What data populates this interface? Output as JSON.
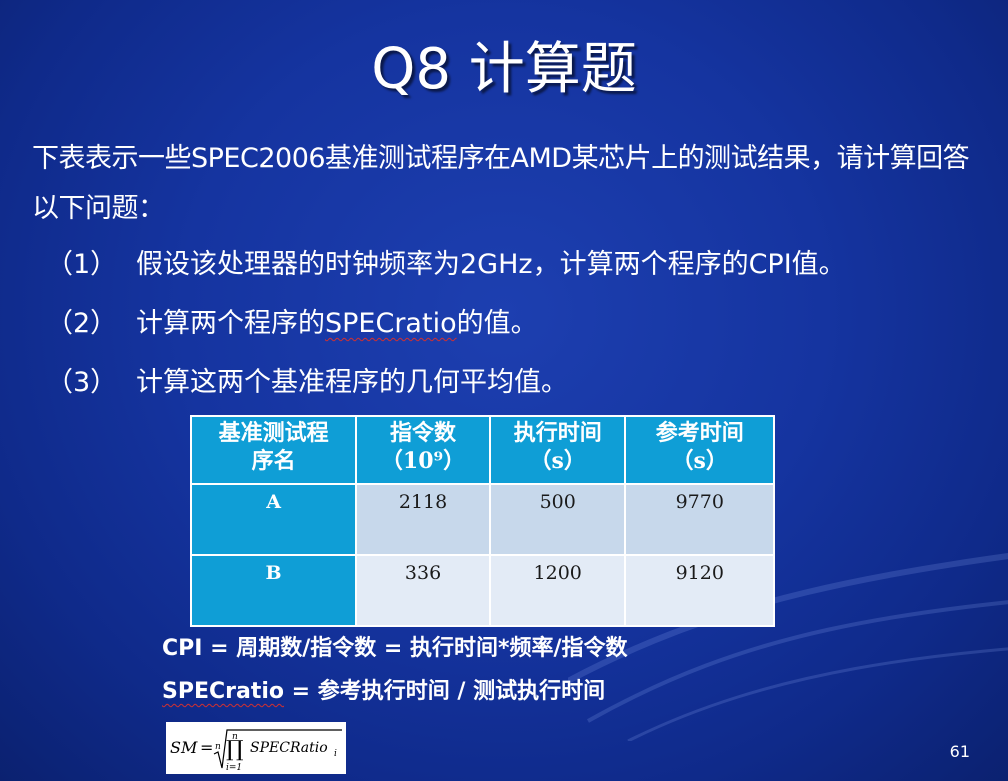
{
  "title": "Q8 计算题",
  "intro": "下表表示一些SPEC2006基准测试程序在AMD某芯片上的测试结果，请计算回答以下问题：",
  "questions": [
    {
      "num": "（1）",
      "text": "假设该处理器的时钟频率为2GHz，计算两个程序的CPI值。"
    },
    {
      "num": "（2）",
      "text_a": "计算两个程序的",
      "text_b": "SPECratio",
      "text_c": "的值。"
    },
    {
      "num": "（3）",
      "text": "计算这两个基准程序的几何平均值。"
    }
  ],
  "table": {
    "headers": [
      {
        "line1": "基准测试程",
        "line2": "序名"
      },
      {
        "line1": "指令数",
        "line2": "（10⁹）"
      },
      {
        "line1": "执行时间",
        "line2": "（s）"
      },
      {
        "line1": "参考时间",
        "line2": "（s）"
      }
    ],
    "rows": [
      {
        "name": "A",
        "instr": "2118",
        "exec": "500",
        "ref": "9770"
      },
      {
        "name": "B",
        "instr": "336",
        "exec": "1200",
        "ref": "9120"
      }
    ]
  },
  "formula1": "CPI = 周期数/指令数 = 执行时间*频率/指令数",
  "formula2_a": "SPECratio",
  "formula2_b": " = 参考执行时间 / 测试执行时间",
  "sm_formula": {
    "lhs": "SM",
    "eq": "=",
    "root_index": "n",
    "prod_upper": "n",
    "prod_lower": "i=1",
    "term": "SPECRatio",
    "sub": "i"
  },
  "page_number": "61",
  "colors": {
    "background": "#1534a0",
    "table_header": "#0f9ed6",
    "row_a": "#c7d8eb",
    "row_b": "#e3ebf6"
  }
}
